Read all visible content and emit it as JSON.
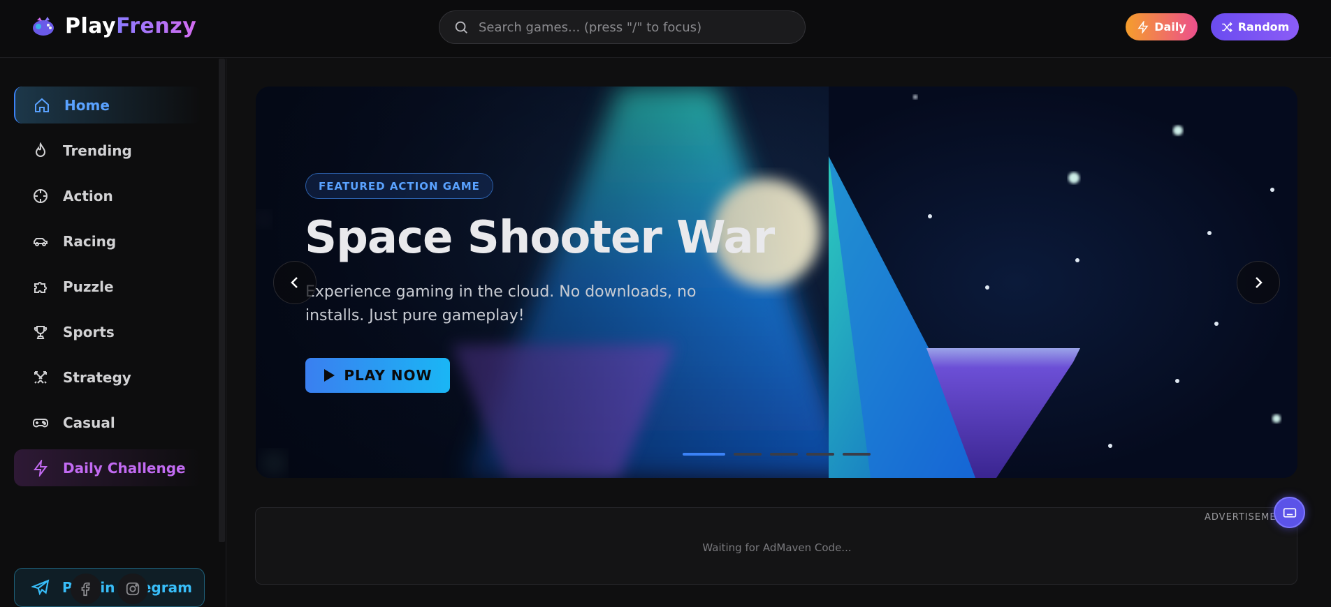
{
  "header": {
    "logo_play": "Play",
    "logo_frenzy": "Frenzy",
    "search_placeholder": "Search games... (press \"/\" to focus)",
    "daily_label": "Daily",
    "random_label": "Random"
  },
  "sidebar": {
    "items": [
      {
        "label": "Home",
        "icon": "home-icon"
      },
      {
        "label": "Trending",
        "icon": "flame-icon"
      },
      {
        "label": "Action",
        "icon": "crosshair-icon"
      },
      {
        "label": "Racing",
        "icon": "car-icon"
      },
      {
        "label": "Puzzle",
        "icon": "puzzle-icon"
      },
      {
        "label": "Sports",
        "icon": "trophy-icon"
      },
      {
        "label": "Strategy",
        "icon": "swords-icon"
      },
      {
        "label": "Casual",
        "icon": "gamepad-icon"
      },
      {
        "label": "Daily Challenge",
        "icon": "lightning-icon"
      }
    ],
    "telegram_label": "Play in Telegram"
  },
  "hero": {
    "badge": "FEATURED ACTION GAME",
    "title": "Space Shooter War",
    "description": "Experience gaming in the cloud. No downloads, no installs. Just pure gameplay!",
    "play_label": "PLAY NOW",
    "slide_count": 5,
    "active_slide": 1
  },
  "ad": {
    "label": "ADVERTISEMENT",
    "waiting_text": "Waiting for AdMaven Code..."
  },
  "colors": {
    "accent_blue": "#3b82f6",
    "accent_purple": "#8b5cf6",
    "daily_orange": "#f59e2c",
    "daily_pink": "#ec4f8c"
  }
}
